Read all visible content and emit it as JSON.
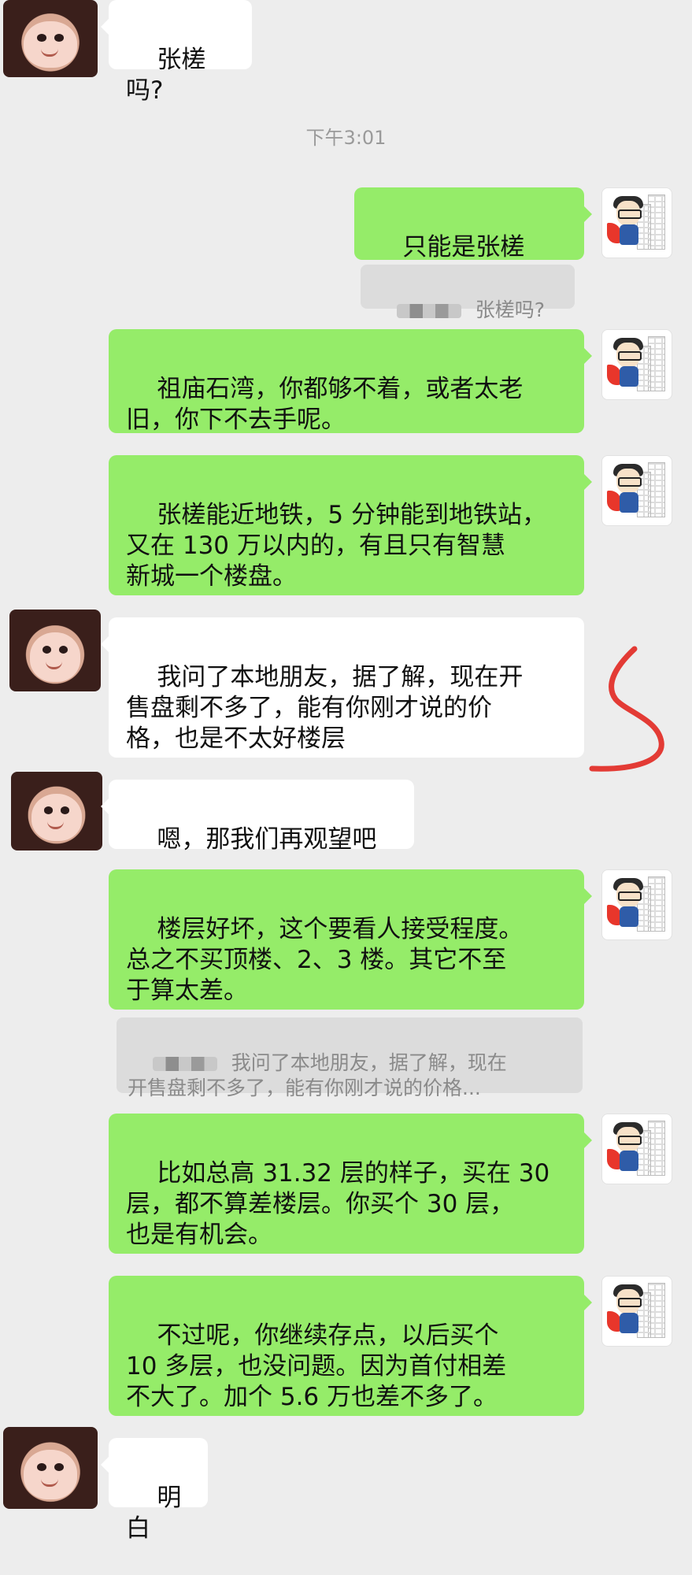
{
  "messages": [
    {
      "text": "张槎吗?"
    },
    {
      "text": "只能是张槎诶。"
    },
    {
      "text": "祖庙石湾，你都够不着，或者太老\n旧，你下不去手呢。"
    },
    {
      "text": "张槎能近地铁，5 分钟能到地铁站，\n又在 130 万以内的，有且只有智慧\n新城一个楼盘。"
    },
    {
      "text": "我问了本地朋友，据了解，现在开\n售盘剩不多了，能有你刚才说的价\n格，也是不太好楼层"
    },
    {
      "text": "嗯，那我们再观望吧"
    },
    {
      "text": "楼层好坏，这个要看人接受程度。\n总之不买顶楼、2、3 楼。其它不至\n于算太差。"
    },
    {
      "text": "比如总高 31.32 层的样子，买在 30\n层，都不算差楼层。你买个 30 层，\n也是有机会。"
    },
    {
      "text": "不过呢，你继续存点，以后买个\n10 多层，也没问题。因为首付相差\n不大了。加个 5.6 万也差不多了。"
    },
    {
      "text": "明白"
    }
  ],
  "timestamp": "下午3:01",
  "quotes": [
    {
      "text": "张槎吗?"
    },
    {
      "text": "我问了本地朋友，据了解，现在\n开售盘剩不多了，能有你刚才说的价格..."
    }
  ],
  "colors": {
    "background": "#ededed",
    "incoming": "#ffffff",
    "outgoing": "#95ec69",
    "annotation": "#e33b35"
  }
}
